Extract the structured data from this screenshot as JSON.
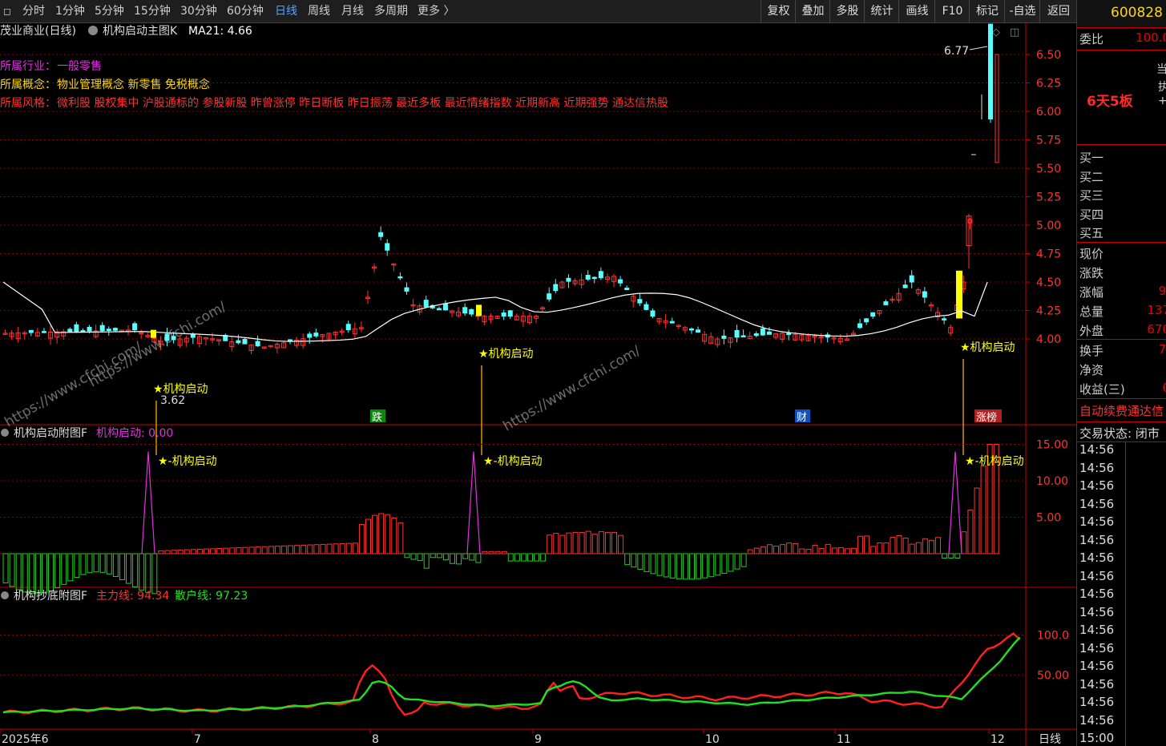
{
  "toolbar": {
    "periods": [
      "分时",
      "1分钟",
      "5分钟",
      "15分钟",
      "30分钟",
      "60分钟",
      "日线",
      "周线",
      "月线",
      "多周期",
      "更多 〉"
    ],
    "active_period": "日线",
    "buttons": [
      "复权",
      "叠加",
      "多股",
      "统计",
      "画线",
      "F10",
      "标记",
      "-自选",
      "返回"
    ]
  },
  "main_chart": {
    "title": "茂业商业(日线)",
    "indicator": "机构启动主图K",
    "ma_label": "MA21: 4.66",
    "info_lines": [
      {
        "label": "所属行业：",
        "value": "一般零售",
        "color": "#e030e0"
      },
      {
        "label": "所属概念：",
        "value": "物业管理概念 新零售 免税概念",
        "color": "#ffd700"
      },
      {
        "label": "所属风格：",
        "value": "微利股 股权集中 沪股通标的 参股新股 昨曾涨停 昨日断板 昨日振荡 最近多板 最近情绪指数 近期新高 近期强势 通达信热股",
        "color": "#ff3030"
      }
    ],
    "price_ticks": [
      "6.50",
      "6.25",
      "6.00",
      "5.75",
      "5.50",
      "5.25",
      "5.00",
      "4.75",
      "4.50",
      "4.25",
      "4.00"
    ],
    "high_label": "6.77",
    "low_label": "3.62",
    "signal_label": "★机构启动",
    "event_badges": [
      "跌",
      "财",
      "涨榜"
    ],
    "watermark": "https://www.cfchi.com/"
  },
  "sub1": {
    "title": "机构启动附图F",
    "value_label": "机构启动: 0.00",
    "ticks": [
      "15.00",
      "10.00",
      "5.00"
    ],
    "signal_label": "★-机构启动"
  },
  "sub2": {
    "title": "机构抄底附图F",
    "main_line_label": "主力线: 94.34",
    "retail_line_label": "散户线: 97.23",
    "ticks": [
      "100.0",
      "50.00"
    ]
  },
  "x_axis": {
    "labels": [
      "2025年6",
      "7",
      "8",
      "9",
      "10",
      "11",
      "12"
    ],
    "period": "日线"
  },
  "right_panel": {
    "code": "600828",
    "weibi_label": "委比",
    "weibi_value": "100.0",
    "board_text": "6天5板",
    "side_chars": [
      "当",
      "执",
      "+"
    ],
    "buy_levels": [
      "买一",
      "买二",
      "买三",
      "买四",
      "买五"
    ],
    "stats": [
      {
        "label": "现价",
        "value": ""
      },
      {
        "label": "涨跌",
        "value": ""
      },
      {
        "label": "涨幅",
        "value": "9."
      },
      {
        "label": "总量",
        "value": "137"
      },
      {
        "label": "外盘",
        "value": "670"
      }
    ],
    "stats2": [
      {
        "label": "换手",
        "value": "7."
      },
      {
        "label": "净资",
        "value": ""
      },
      {
        "label": "收益(三)",
        "value": "0"
      }
    ],
    "auto_renew": "自动续费通达信",
    "trade_status": "交易状态: 闭市",
    "times": [
      "14:56",
      "14:56",
      "14:56",
      "14:56",
      "14:56",
      "14:56",
      "14:56",
      "14:56",
      "14:56",
      "14:56",
      "14:56",
      "14:56",
      "14:56",
      "14:56",
      "14:56",
      "14:56",
      "15:00"
    ]
  },
  "colors": {
    "up": "#ff3333",
    "down": "#54ffff",
    "signal": "#ffff00",
    "ma": "#ffffff",
    "main_line": "#ff2020",
    "retail_line": "#20e020",
    "grid": "#8b0000"
  }
}
